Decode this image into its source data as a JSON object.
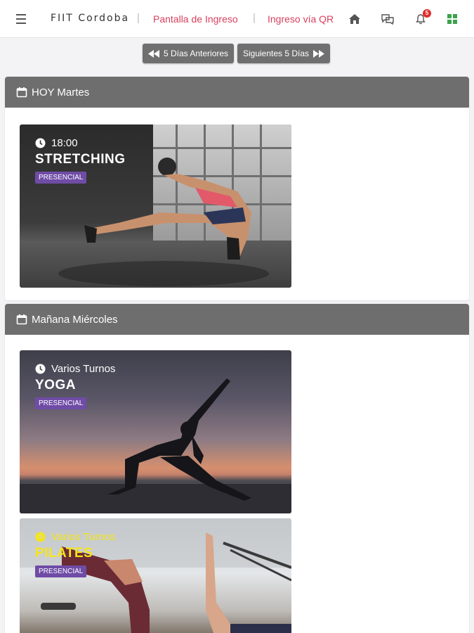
{
  "header": {
    "brand": "FIIT Cordoba",
    "links": [
      "Pantalla de Ingreso",
      "Ingreso vía QR"
    ],
    "notification_count": "5",
    "icons": [
      "menu-icon",
      "home-icon",
      "chat-icon",
      "bell-icon",
      "grid-icon"
    ]
  },
  "pager": {
    "prev_label": "5 Días Anteriores",
    "next_label": "Siguientes 5 Días"
  },
  "sections": [
    {
      "title": "HOY Martes",
      "classes": [
        {
          "time": "18:00",
          "name": "STRETCHING",
          "mode": "PRESENCIAL"
        }
      ]
    },
    {
      "title": "Mañana Miércoles",
      "classes": [
        {
          "time": "Varios Turnos",
          "name": "YOGA",
          "mode": "PRESENCIAL"
        },
        {
          "time": "Varios Turnos",
          "name": "PILATES",
          "mode": "PRESENCIAL"
        }
      ]
    }
  ],
  "colors": {
    "link": "#d9415d",
    "section_header": "#6e6e6e",
    "badge": "#6f4ca6",
    "pilates_text": "#f5e51a",
    "notification": "#e02d2d",
    "grid_icon": "#3aa34a"
  }
}
